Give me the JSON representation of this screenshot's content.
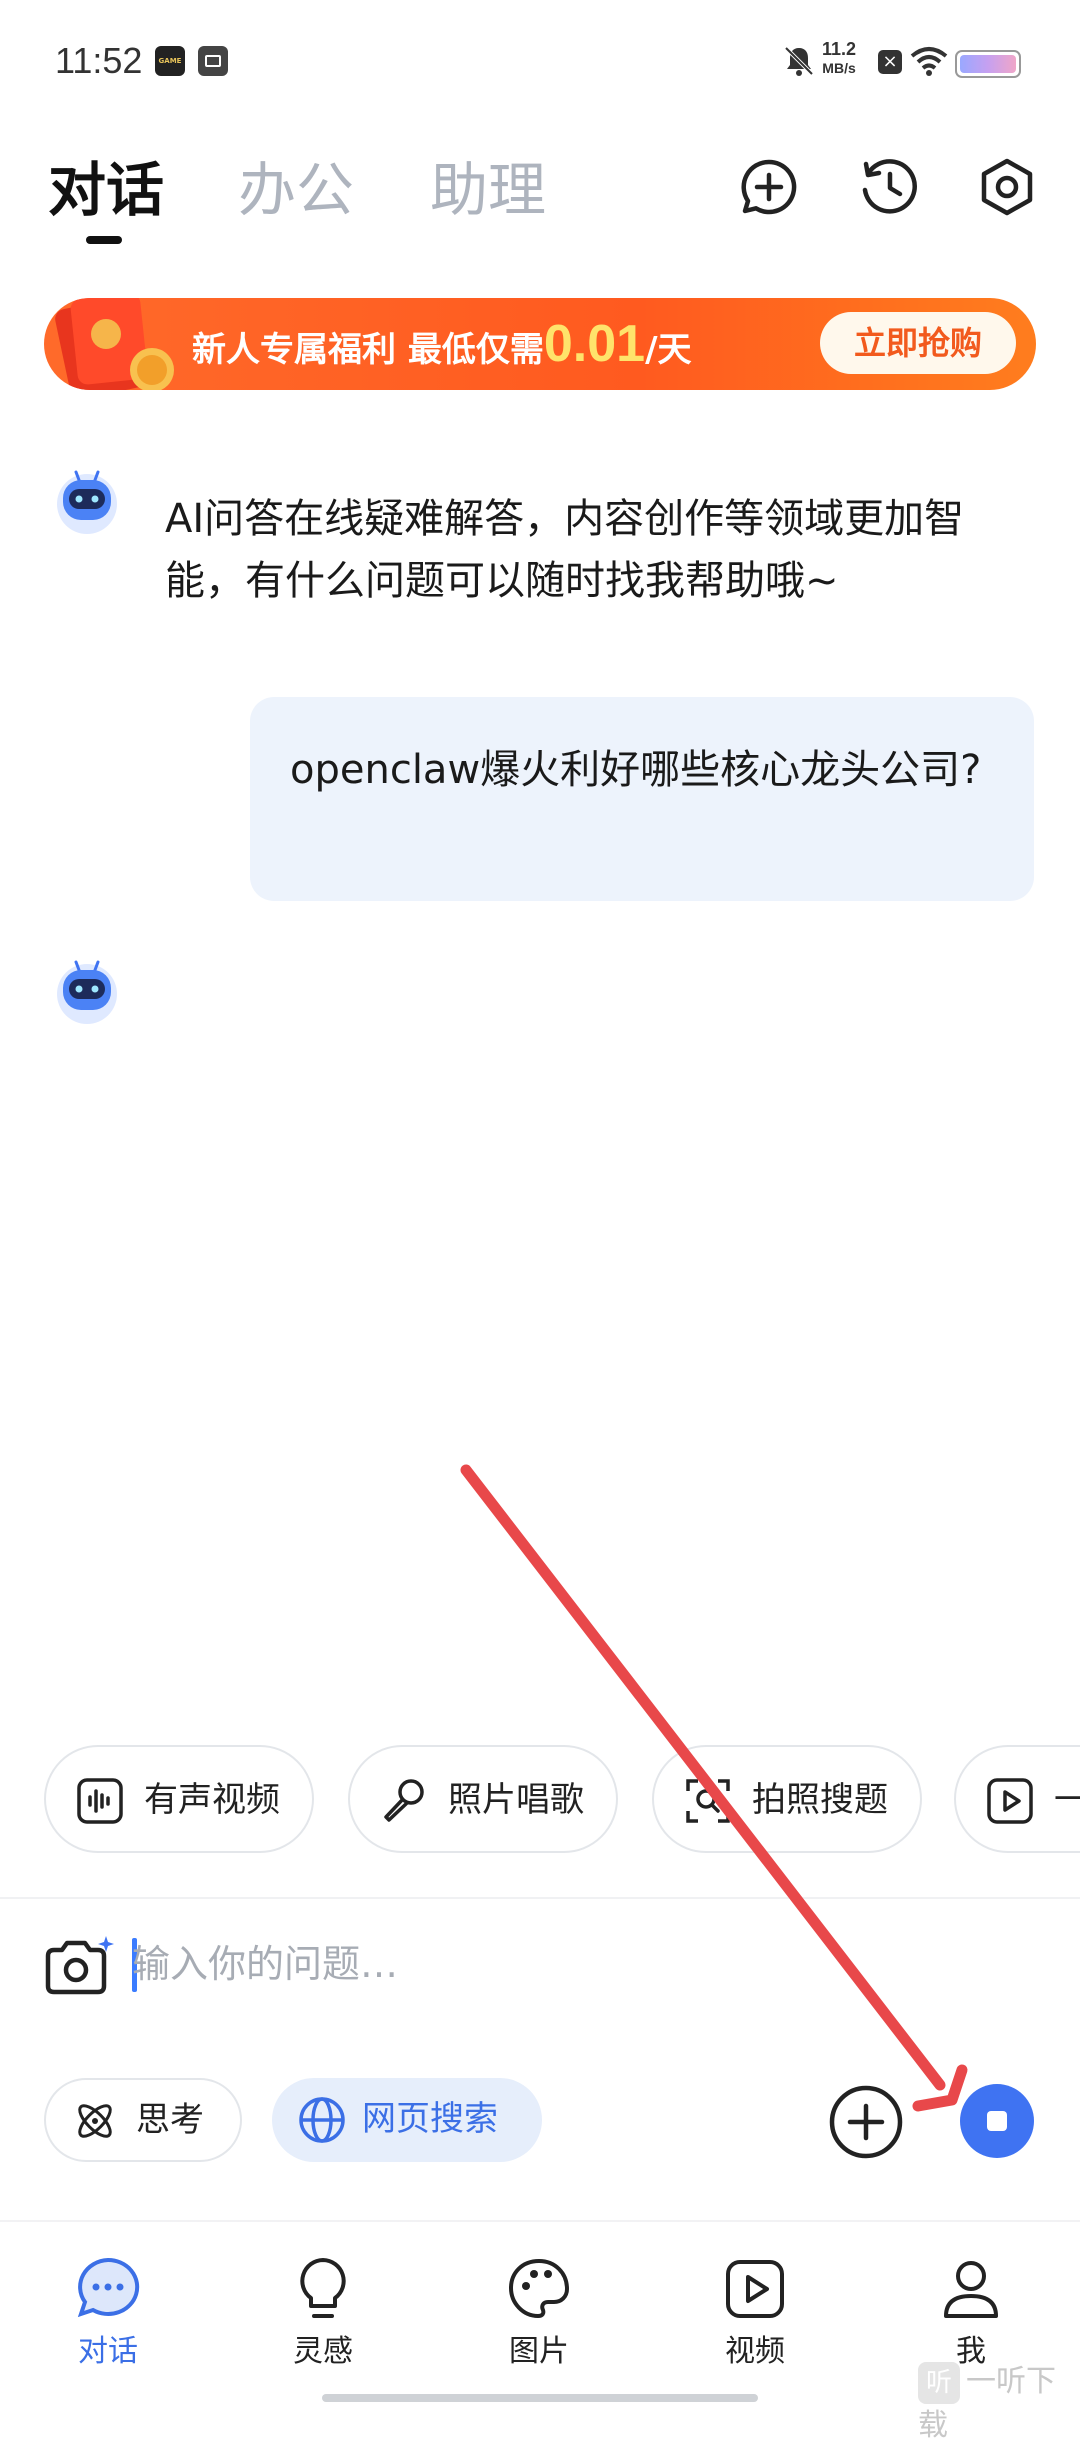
{
  "status_bar": {
    "time": "11:52",
    "net_speed_value": "11.2",
    "net_speed_unit": "MB/s",
    "app_icon_1_text": "GAME"
  },
  "header": {
    "tabs": [
      {
        "label": "对话",
        "active": true
      },
      {
        "label": "办公",
        "active": false
      },
      {
        "label": "助理",
        "active": false
      }
    ],
    "actions": [
      "new-chat-icon",
      "history-icon",
      "settings-icon"
    ]
  },
  "banner": {
    "text_before": "新人专属福利 最低仅需",
    "price": "0.01",
    "text_after": "/天",
    "button_label": "立即抢购"
  },
  "chat": {
    "messages": [
      {
        "role": "assistant",
        "text": "AI问答在线疑难解答，内容创作等领域更加智能，有什么问题可以随时找我帮助哦~"
      },
      {
        "role": "user",
        "text": "openclaw爆火利好哪些核心龙头公司?"
      },
      {
        "role": "assistant",
        "text": ""
      }
    ]
  },
  "quick_actions": [
    {
      "label": "有声视频",
      "icon": "waveform-icon"
    },
    {
      "label": "照片唱歌",
      "icon": "microphone-icon"
    },
    {
      "label": "拍照搜题",
      "icon": "scan-icon"
    },
    {
      "label": "一",
      "icon": "play-icon"
    }
  ],
  "input": {
    "placeholder": "输入你的问题…",
    "think_label": "思考",
    "web_search_label": "网页搜索",
    "web_search_active": true
  },
  "bottom_nav": [
    {
      "label": "对话",
      "icon": "chat-bubble-icon",
      "active": true
    },
    {
      "label": "灵感",
      "icon": "lightbulb-icon",
      "active": false
    },
    {
      "label": "图片",
      "icon": "palette-icon",
      "active": false
    },
    {
      "label": "视频",
      "icon": "video-play-icon",
      "active": false
    },
    {
      "label": "我",
      "icon": "user-icon",
      "active": false
    }
  ],
  "watermark": {
    "logo": "听",
    "text": "一听下载"
  },
  "colors": {
    "accent": "#3b6fe6",
    "banner": "#ff5a1f",
    "user_bubble": "#edf3fc",
    "annotation_arrow": "#e8484a"
  }
}
